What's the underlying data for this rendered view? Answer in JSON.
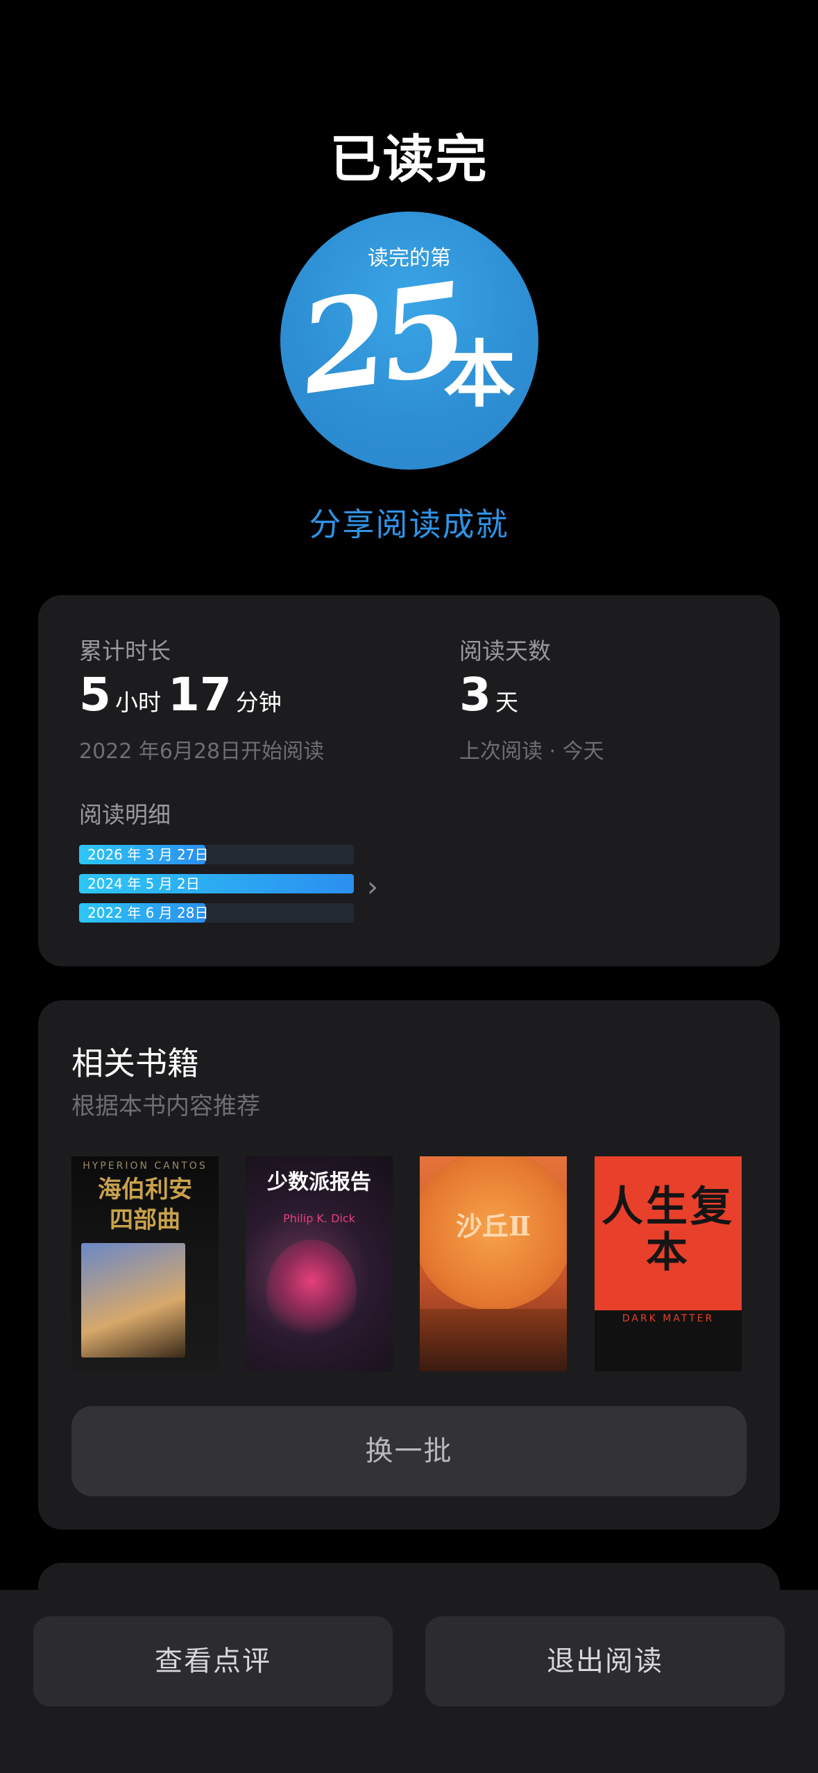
{
  "page_title": "已读完",
  "badge": {
    "top_text": "读完的第",
    "number": "25",
    "unit": "本",
    "colors": [
      "#3aa5e6",
      "#2a86cb"
    ]
  },
  "share_link": "分享阅读成就",
  "stats": {
    "duration_label": "累计时长",
    "duration_hours": "5",
    "duration_hours_unit": "小时",
    "duration_minutes": "17",
    "duration_minutes_unit": "分钟",
    "start_text": "2022 年6月28日开始阅读",
    "days_label": "阅读天数",
    "days_value": "3",
    "days_unit": "天",
    "last_read_text": "上次阅读 · 今天",
    "detail_label": "阅读明细",
    "detail_rows": [
      {
        "text": "2026 年 3 月 27日",
        "fill": 0.46
      },
      {
        "text": "2024 年 5 月 2日",
        "fill": 1.0
      },
      {
        "text": "2022 年 6 月 28日",
        "fill": 0.46
      }
    ]
  },
  "related": {
    "title": "相关书籍",
    "subtitle": "根据本书内容推荐",
    "books": [
      {
        "cover_title": "海伯利安\n四部曲",
        "cover_top": "HYPERION CANTOS",
        "accent": "#c9a24b"
      },
      {
        "cover_title": "少数派报告",
        "cover_top": "Philip K. Dick",
        "accent": "#e5407b"
      },
      {
        "cover_title": "沙丘Ⅱ",
        "cover_top": "",
        "accent": "#f08a2a"
      },
      {
        "cover_title": "人生复本",
        "cover_top": "DARK MATTER",
        "accent": "#e8402a"
      }
    ],
    "refresh_label": "换一批"
  },
  "bottom_bar": {
    "review_label": "查看点评",
    "exit_label": "退出阅读"
  }
}
